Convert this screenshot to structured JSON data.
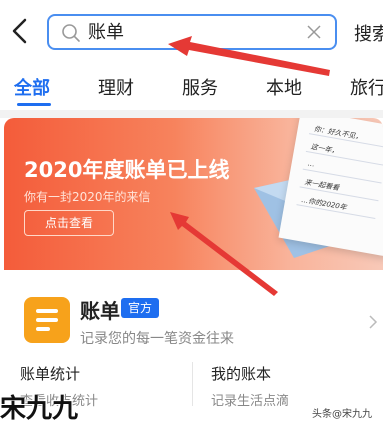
{
  "header": {
    "back_icon": "back-arrow-icon",
    "search_query": "账单",
    "search_button": "搜索"
  },
  "tabs": [
    {
      "label": "全部",
      "active": true
    },
    {
      "label": "理财",
      "active": false
    },
    {
      "label": "服务",
      "active": false
    },
    {
      "label": "本地",
      "active": false
    },
    {
      "label": "旅行",
      "active": false
    }
  ],
  "banner": {
    "title": "2020年度账单已上线",
    "subtitle": "你有一封2020年的来信",
    "button": "点击查看",
    "letter_lines": [
      "你：好久不见，",
      "这一年，",
      "…",
      "来一起看看",
      "…你的2020年"
    ]
  },
  "bill_card": {
    "name": "账单",
    "badge": "官方",
    "description": "记录您的每一笔资金往来",
    "left_title": "账单统计",
    "left_sub": "查看收支统计",
    "right_title": "我的账本",
    "right_sub": "记录生活点滴"
  },
  "watermark": {
    "left": "宋九九",
    "right": "头条@宋九九"
  },
  "colors": {
    "accent": "#1e6ef0",
    "banner_start": "#f45c3a",
    "app_icon": "#f7a21b",
    "annotation_arrow": "#e53935"
  }
}
